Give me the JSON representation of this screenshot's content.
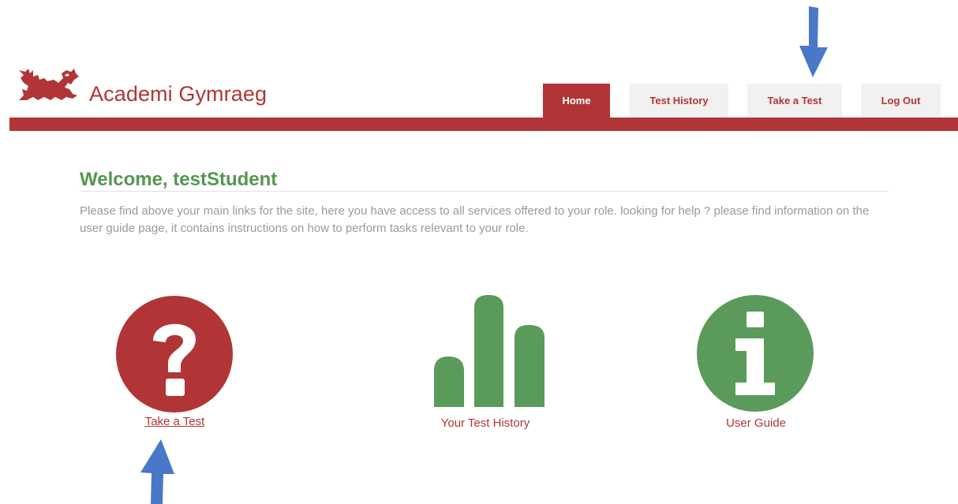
{
  "header": {
    "brand": "Academi Gymraeg",
    "logo_icon": "welsh-dragon-icon",
    "brand_color": "#b13536"
  },
  "nav": {
    "tabs": [
      {
        "label": "Home",
        "active": true
      },
      {
        "label": "Test History",
        "active": false
      },
      {
        "label": "Take a Test",
        "active": false
      },
      {
        "label": "Log Out",
        "active": false
      }
    ]
  },
  "main": {
    "welcome": "Welcome, testStudent",
    "intro": "Please find above your main links for the site, here you have access to all services offered to your role. looking for help ? please find information on the user guide page, it contains instructions on how to perform tasks relevant to your role."
  },
  "tiles": [
    {
      "label": "Take a Test",
      "icon": "question-circle-icon",
      "color": "#b13536"
    },
    {
      "label": "Your Test History",
      "icon": "bar-chart-icon",
      "color": "#5a9a5a"
    },
    {
      "label": "User Guide",
      "icon": "info-circle-icon",
      "color": "#5a9a5a"
    }
  ],
  "annotations": {
    "arrow_color": "#4a78c8"
  }
}
